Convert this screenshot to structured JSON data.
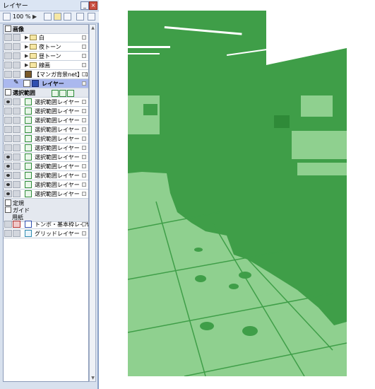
{
  "panel": {
    "title": "レイヤー",
    "minimize_glyph": "_",
    "close_glyph": "×",
    "zoom_value": "100 %",
    "play_glyph": "▶"
  },
  "layers": {
    "folder_header": "画像",
    "folder_children": [
      {
        "label": "白",
        "vis": false
      },
      {
        "label": "夜トーン",
        "vis": false
      },
      {
        "label": "昼トーン",
        "vis": false
      },
      {
        "label": "線画",
        "vis": false
      }
    ],
    "logo_layer": "【マンガ背景net】ロゴ",
    "selected_layer": "レイヤー",
    "selection_header": "選択範囲",
    "selection_layers": [
      {
        "label": "選択範囲レイヤー",
        "vis": true
      },
      {
        "label": "選択範囲レイヤー",
        "vis": false
      },
      {
        "label": "選択範囲レイヤー",
        "vis": false
      },
      {
        "label": "選択範囲レイヤー",
        "vis": false
      },
      {
        "label": "選択範囲レイヤー",
        "vis": false
      },
      {
        "label": "選択範囲レイヤー",
        "vis": false
      },
      {
        "label": "選択範囲レイヤー",
        "vis": true
      },
      {
        "label": "選択範囲レイヤー",
        "vis": true
      },
      {
        "label": "選択範囲レイヤー",
        "vis": true
      },
      {
        "label": "選択範囲レイヤー",
        "vis": true
      },
      {
        "label": "選択範囲レイヤー",
        "vis": true
      }
    ],
    "group_ruler": "定規",
    "group_guide": "ガイド",
    "group_paper": "用紙",
    "paper_layers": [
      "トンボ・基本枠レイヤー",
      "グリッドレイヤー"
    ]
  },
  "colors": {
    "fill_dark": "#3f9e48",
    "fill_light": "#8fd08f",
    "panel_bg": "#d8e1ee",
    "selected_row": "#aab8ee"
  }
}
